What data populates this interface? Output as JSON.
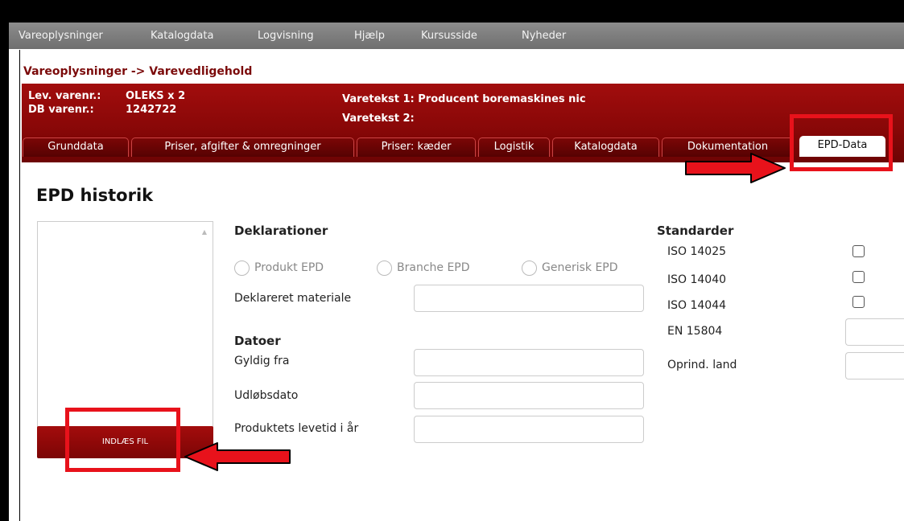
{
  "nav": {
    "items": [
      "Vareoplysninger",
      "Katalogdata",
      "Logvisning",
      "Hjælp",
      "Kursusside",
      "Nyheder"
    ]
  },
  "breadcrumb": "Vareoplysninger -> Varevedligehold",
  "header": {
    "lev_label": "Lev. varenr.:",
    "lev_value": "OLEKS x 2",
    "db_label": "DB varenr.:",
    "db_value": "1242722",
    "varetekst1": "Varetekst 1: Producent boremaskines nic",
    "varetekst2": "Varetekst 2:"
  },
  "tabs": [
    {
      "label": "Grunddata",
      "active": false
    },
    {
      "label": "Priser, afgifter & omregninger",
      "active": false
    },
    {
      "label": "Priser: kæder",
      "active": false
    },
    {
      "label": "Logistik",
      "active": false
    },
    {
      "label": "Katalogdata",
      "active": false
    },
    {
      "label": "Dokumentation",
      "active": false
    },
    {
      "label": "EPD-Data",
      "active": true
    }
  ],
  "content": {
    "heading": "EPD historik",
    "upload_button": "INDLÆS FIL",
    "deklarationer": {
      "heading": "Deklarationer",
      "radios": [
        "Produkt EPD",
        "Branche EPD",
        "Generisk EPD"
      ],
      "materiale_label": "Deklareret materiale",
      "materiale_value": ""
    },
    "datoer": {
      "heading": "Datoer",
      "gyldig_label": "Gyldig fra",
      "gyldig_value": "",
      "udlob_label": "Udløbsdato",
      "udlob_value": "",
      "levetid_label": "Produktets levetid i år",
      "levetid_value": ""
    },
    "standarder": {
      "heading": "Standarder",
      "iso14025": "ISO 14025",
      "iso14040": "ISO 14040",
      "iso14044": "ISO 14044",
      "en15804": "EN 15804",
      "oprind": "Oprind. land",
      "en15804_value": "",
      "oprind_value": ""
    }
  },
  "colors": {
    "header_maroon": "#8b0808",
    "annotation_red": "#e8121b",
    "nav_gray": "#7d7d7d"
  }
}
